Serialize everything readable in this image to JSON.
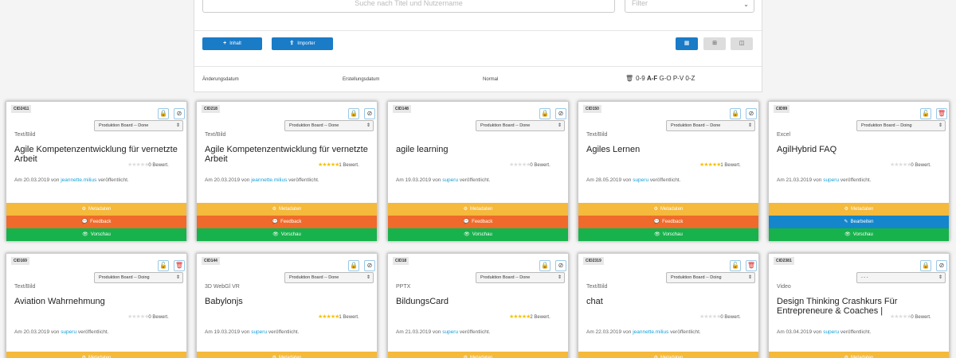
{
  "search": {
    "placeholder": "Suche nach Titel und Nutzername",
    "filter_label": "Filter"
  },
  "toolbar": {
    "add_label": "Inhalt",
    "import_label": "Importer"
  },
  "sort": {
    "changed": "Änderungsdatum",
    "created": "Erstellungsdatum",
    "normal": "Normal",
    "alpha_prefix": "0-9",
    "alpha_active": "A-F",
    "alpha_rest": "G-O P-V 0-Z"
  },
  "cards": [
    {
      "cid": "CID2411",
      "status": "Produktion Board -- Done",
      "type": "Text/Bild",
      "title": "Agile Kompetenzentwicklung für vernetzte Arbeit",
      "date": "Am 20.03.2019 von",
      "user": "jeannette.milius",
      "suffix": "veröffentlicht.",
      "rating_text": "0 Bewert.",
      "stars": 0,
      "locked": true,
      "btn2": "ban",
      "bars": [
        "Metadaten",
        "Feedback",
        "Vorschau"
      ]
    },
    {
      "cid": "CID218",
      "status": "Produktion Board -- Done",
      "type": "Text/Bild",
      "title": "Agile Kompetenzentwicklung für vernetzte Arbeit",
      "date": "Am 20.03.2019 von",
      "user": "jeannette.milius",
      "suffix": "veröffentlicht.",
      "rating_text": "1 Bewert.",
      "stars": 5,
      "locked": true,
      "btn2": "ban",
      "bars": [
        "Metadaten",
        "Feedback",
        "Vorschau"
      ]
    },
    {
      "cid": "CID148",
      "status": "Produktion Board -- Done",
      "type": "",
      "title": "agile learning",
      "date": "Am 19.03.2019 von",
      "user": "superu",
      "suffix": "veröffentlicht.",
      "rating_text": "0 Bewert.",
      "stars": 0,
      "locked": true,
      "btn2": "ban",
      "bars": [
        "Metadaten",
        "Feedback",
        "Vorschau"
      ]
    },
    {
      "cid": "CID150",
      "status": "Produktion Board -- Done",
      "type": "Text/Bild",
      "title": "Agiles Lernen",
      "date": "Am 28.05.2019 von",
      "user": "superu",
      "suffix": "veröffentlicht.",
      "rating_text": "1 Bewert.",
      "stars": 5,
      "locked": true,
      "btn2": "ban",
      "bars": [
        "Metadaten",
        "Feedback",
        "Vorschau"
      ]
    },
    {
      "cid": "CID99",
      "status": "Produktion Board -- Doing",
      "type": "Excel",
      "title": "AgilHybrid FAQ",
      "date": "Am 21.03.2019 von",
      "user": "superu",
      "suffix": "veröffentlicht.",
      "rating_text": "0 Bewert.",
      "stars": 0,
      "locked": false,
      "btn2": "delete",
      "bars": [
        "Metadaten",
        "Bearbeiten",
        "Vorschau"
      ]
    },
    {
      "cid": "CID169",
      "status": "Produktion Board -- Doing",
      "type": "Text/Bild",
      "title": "Aviation Wahrnehmung",
      "date": "Am 20.03.2019 von",
      "user": "superu",
      "suffix": "veröffentlicht.",
      "rating_text": "0 Bewert.",
      "stars": 0,
      "locked": false,
      "btn2": "delete",
      "bars": [
        "Metadaten"
      ]
    },
    {
      "cid": "CID144",
      "status": "Produktion Board -- Done",
      "type": "3D WebGl VR",
      "title": "Babylonjs",
      "date": "Am 19.03.2019 von",
      "user": "superu",
      "suffix": "veröffentlicht.",
      "rating_text": "1 Bewert.",
      "stars": 5,
      "locked": true,
      "btn2": "ban",
      "bars": [
        "Metadaten"
      ]
    },
    {
      "cid": "CID18",
      "status": "Produktion Board -- Done",
      "type": "PPTX",
      "title": "BildungsCard",
      "date": "Am 21.03.2019 von",
      "user": "superu",
      "suffix": "veröffentlicht.",
      "rating_text": "2 Bewert.",
      "stars": 5,
      "locked": true,
      "btn2": "ban",
      "bars": [
        "Metadaten"
      ]
    },
    {
      "cid": "CID2319",
      "status": "Produktion Board -- Doing",
      "type": "Text/Bild",
      "title": "chat",
      "date": "Am 22.03.2019 von",
      "user": "jeannette.milius",
      "suffix": "veröffentlicht.",
      "rating_text": "0 Bewert.",
      "stars": 0,
      "locked": false,
      "btn2": "delete",
      "bars": [
        "Metadaten"
      ]
    },
    {
      "cid": "CID2381",
      "status": "- - -",
      "type": "Video",
      "title": "Design Thinking Crashkurs Für Entrepreneure & Coaches |",
      "date": "Am 03.04.2019 von",
      "user": "superu",
      "suffix": "veröffentlicht.",
      "rating_text": "0 Bewert.",
      "stars": 0,
      "locked": true,
      "btn2": "ban",
      "bars": [
        "Metadaten"
      ]
    }
  ],
  "colors": {
    "primary": "#1a7bc7",
    "meta": "#f5b93b",
    "feedback": "#ef6a2b",
    "edit": "#1586cc",
    "preview": "#17b24b",
    "link": "#1aa0d8"
  }
}
